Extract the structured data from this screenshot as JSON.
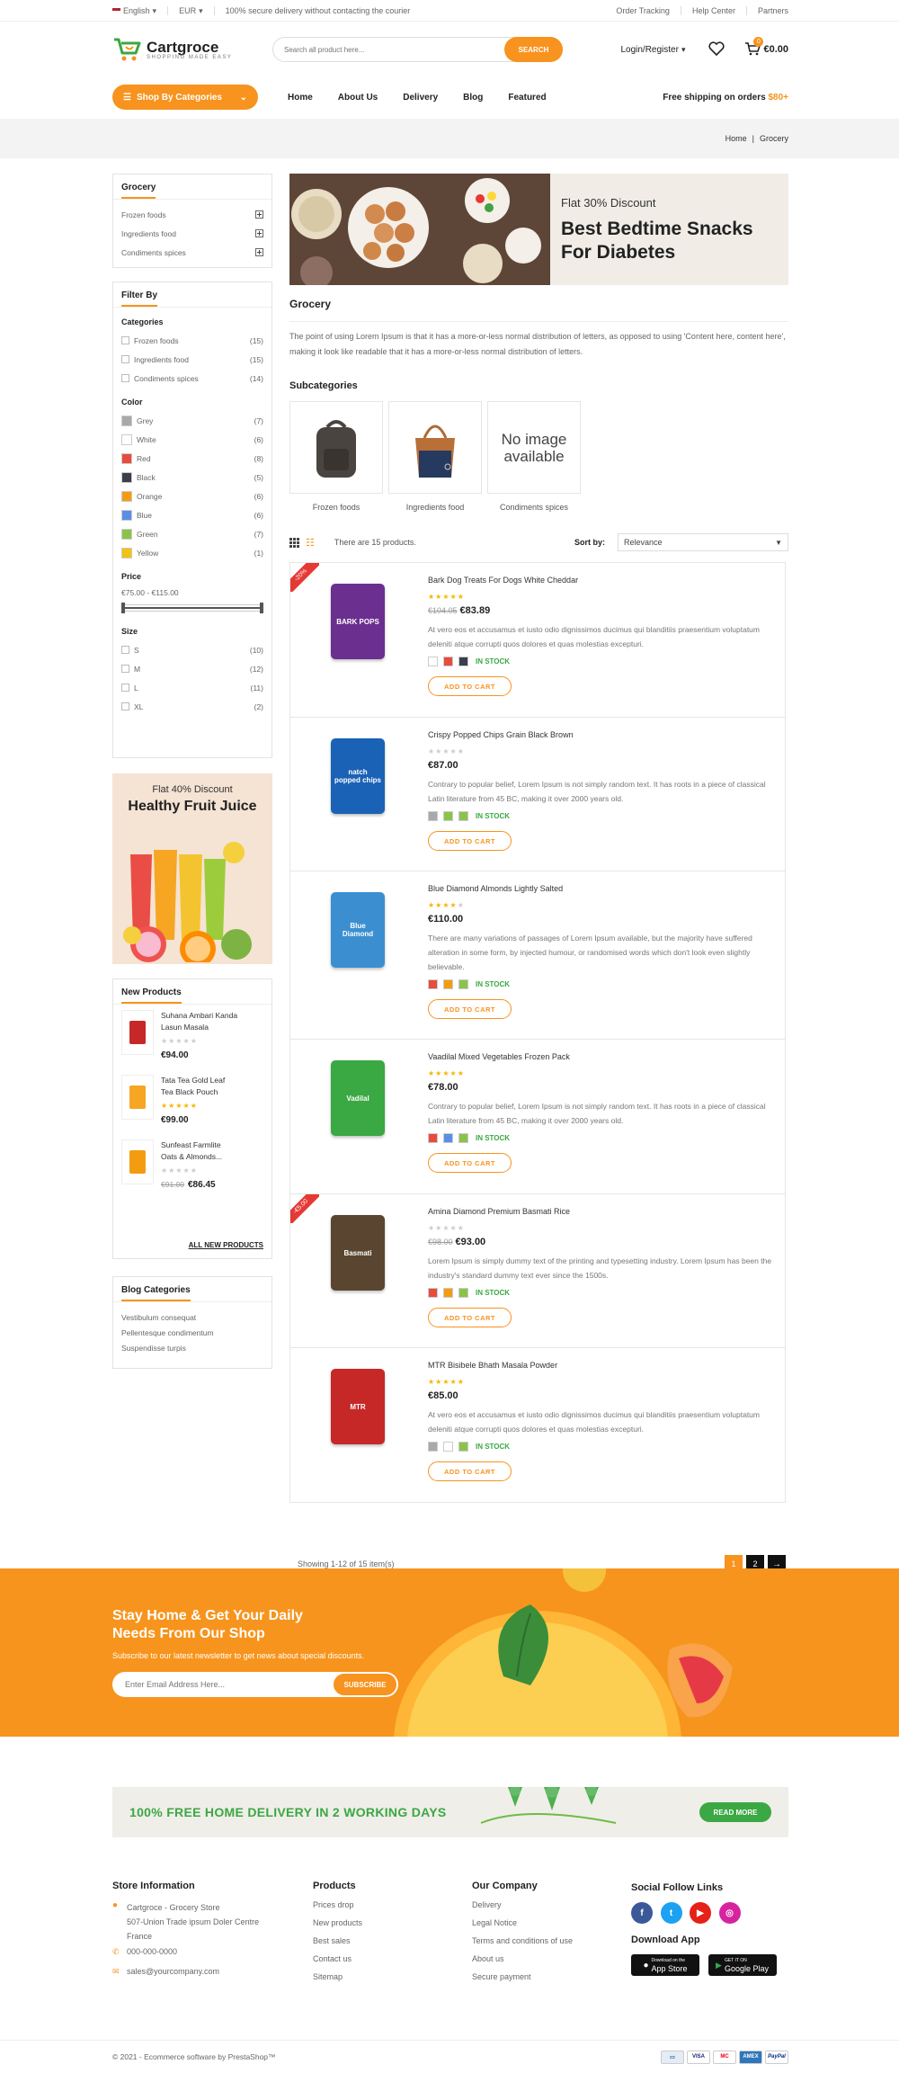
{
  "topbar": {
    "language": "English",
    "currency": "EUR",
    "notice": "100% secure delivery without contacting the courier",
    "links": [
      "Order Tracking",
      "Help Center",
      "Partners"
    ]
  },
  "header": {
    "brand": "Cartgroce",
    "tagline": "SHOPPING MADE EASY",
    "search_placeholder": "Search all product here...",
    "search_button": "SEARCH",
    "account": "Login/Register",
    "cart_count": "0",
    "cart_total": "€0.00"
  },
  "nav": {
    "categories_button": "Shop By Categories",
    "menu": [
      "Home",
      "About Us",
      "Delivery",
      "Blog",
      "Featured"
    ],
    "free_shipping_text": "Free shipping on orders",
    "free_shipping_amount": "$80+"
  },
  "breadcrumb": {
    "home": "Home",
    "sep": "|",
    "current": "Grocery"
  },
  "sidebar": {
    "grocery": {
      "title": "Grocery",
      "items": [
        "Frozen foods",
        "Ingredients food",
        "Condiments spices"
      ]
    },
    "filter": {
      "title": "Filter By",
      "categories_title": "Categories",
      "categories": [
        {
          "label": "Frozen foods",
          "count": "(15)"
        },
        {
          "label": "Ingredients food",
          "count": "(15)"
        },
        {
          "label": "Condiments spices",
          "count": "(14)"
        }
      ],
      "color_title": "Color",
      "colors": [
        {
          "label": "Grey",
          "count": "(7)",
          "hex": "#a7a9ac"
        },
        {
          "label": "White",
          "count": "(6)",
          "hex": "#ffffff"
        },
        {
          "label": "Red",
          "count": "(8)",
          "hex": "#e74c3c"
        },
        {
          "label": "Black",
          "count": "(5)",
          "hex": "#3a3f4b"
        },
        {
          "label": "Orange",
          "count": "(6)",
          "hex": "#f39c12"
        },
        {
          "label": "Blue",
          "count": "(6)",
          "hex": "#5b8fe6"
        },
        {
          "label": "Green",
          "count": "(7)",
          "hex": "#8bc34a"
        },
        {
          "label": "Yellow",
          "count": "(1)",
          "hex": "#f1c40f"
        }
      ],
      "price_title": "Price",
      "price_range": "€75.00 - €115.00",
      "size_title": "Size",
      "sizes": [
        {
          "label": "S",
          "count": "(10)"
        },
        {
          "label": "M",
          "count": "(12)"
        },
        {
          "label": "L",
          "count": "(11)"
        },
        {
          "label": "XL",
          "count": "(2)"
        }
      ]
    },
    "promo": {
      "line1": "Flat 40% Discount",
      "line2": "Healthy Fruit Juice"
    },
    "new_products": {
      "title": "New Products",
      "items": [
        {
          "name1": "Suhana Ambari Kanda",
          "name2": "Lasun Masala",
          "price": "€94.00",
          "old_price": "",
          "rated": false
        },
        {
          "name1": "Tata Tea Gold Leaf",
          "name2": "Tea Black Pouch",
          "price": "€99.00",
          "old_price": "",
          "rated": true
        },
        {
          "name1": "Sunfeast Farmlite",
          "name2": "Oats & Almonds...",
          "price": "€86.45",
          "old_price": "€91.00",
          "rated": false
        }
      ],
      "all_link": "ALL NEW PRODUCTS"
    },
    "blog": {
      "title": "Blog Categories",
      "items": [
        "Vestibulum consequat",
        "Pellentesque condimentum",
        "Suspendisse turpis"
      ]
    }
  },
  "main": {
    "banner": {
      "line1": "Flat 30% Discount",
      "line2": "Best Bedtime Snacks",
      "line3": "For Diabetes"
    },
    "title": "Grocery",
    "description": "The point of using Lorem Ipsum is that it has a more-or-less normal distribution of letters, as opposed to using 'Content here, content here', making it look like readable that it has a more-or-less normal distribution of letters.",
    "subcategories_title": "Subcategories",
    "subcategories": [
      {
        "label": "Frozen foods"
      },
      {
        "label": "Ingredients food"
      },
      {
        "label": "Condiments spices",
        "no_image_text": "No image available"
      }
    ],
    "toolbar": {
      "count_text": "There are 15 products.",
      "sort_label": "Sort by:",
      "sort_value": "Relevance"
    },
    "products": [
      {
        "name": "Bark Dog Treats For Dogs White Cheddar",
        "stars": 5,
        "old_price": "€104.05",
        "price": "€83.89",
        "badge": "-20%",
        "desc": "At vero eos et accusamus et iusto odio dignissimos ducimus qui blanditiis praesentium voluptatum deleniti atque corrupti quos dolores et quas molestias excepturi.",
        "colors": [
          "#ffffff",
          "#e74c3c",
          "#3a3f4b"
        ],
        "stock": "IN STOCK",
        "cart": "ADD TO CART",
        "label": "BARK POPS",
        "img_color": "#6b2f8f"
      },
      {
        "name": "Crispy Popped Chips Grain Black Brown",
        "stars": 0,
        "old_price": "",
        "price": "€87.00",
        "badge": "",
        "desc": "Contrary to popular belief, Lorem Ipsum is not simply random text. It has roots in a piece of classical Latin literature from 45 BC, making it over 2000 years old.",
        "colors": [
          "#a7a9ac",
          "#8bc34a",
          "#8bc34a"
        ],
        "stock": "IN STOCK",
        "cart": "ADD TO CART",
        "label": "natch popped chips",
        "img_color": "#1a62b5"
      },
      {
        "name": "Blue Diamond Almonds Lightly Salted",
        "stars": 4,
        "old_price": "",
        "price": "€110.00",
        "badge": "",
        "desc": "There are many variations of passages of Lorem Ipsum available, but the majority have suffered alteration in some form, by injected humour, or randomised words which don't look even slightly believable.",
        "colors": [
          "#e74c3c",
          "#f39c12",
          "#8bc34a"
        ],
        "stock": "IN STOCK",
        "cart": "ADD TO CART",
        "label": "Blue Diamond",
        "img_color": "#3b8fd0"
      },
      {
        "name": "Vaadilal Mixed Vegetables Frozen Pack",
        "stars": 5,
        "old_price": "",
        "price": "€78.00",
        "badge": "",
        "desc": "Contrary to popular belief, Lorem Ipsum is not simply random text. It has roots in a piece of classical Latin literature from 45 BC, making it over 2000 years old.",
        "colors": [
          "#e74c3c",
          "#5b8fe6",
          "#8bc34a"
        ],
        "stock": "IN STOCK",
        "cart": "ADD TO CART",
        "label": "Vadilal",
        "img_color": "#3aa843"
      },
      {
        "name": "Amina Diamond Premium Basmati Rice",
        "stars": 0,
        "old_price": "€98.00",
        "price": "€93.00",
        "badge": "-€5.00",
        "desc": "Lorem Ipsum is simply dummy text of the printing and typesetting industry. Lorem Ipsum has been the industry's standard dummy text ever since the 1500s.",
        "colors": [
          "#e74c3c",
          "#f39c12",
          "#8bc34a"
        ],
        "stock": "IN STOCK",
        "cart": "ADD TO CART",
        "label": "Basmati",
        "img_color": "#5a4630"
      },
      {
        "name": "MTR Bisibele Bhath Masala Powder",
        "stars": 5,
        "old_price": "",
        "price": "€85.00",
        "badge": "",
        "desc": "At vero eos et accusamus et iusto odio dignissimos ducimus qui blanditiis praesentium voluptatum deleniti atque corrupti quos dolores et quas molestias excepturi.",
        "colors": [
          "#a7a9ac",
          "#ffffff",
          "#8bc34a"
        ],
        "stock": "IN STOCK",
        "cart": "ADD TO CART",
        "label": "MTR",
        "img_color": "#c62828"
      }
    ],
    "pagination": {
      "showing": "Showing 1-12 of 15 item(s)",
      "pages": [
        "1",
        "2"
      ],
      "next": "→"
    }
  },
  "newsletter": {
    "line1": "Stay Home & Get Your Daily",
    "line2": "Needs From Our Shop",
    "sub": "Subscribe to our latest newsletter to get news about special discounts.",
    "placeholder": "Enter Email Address Here...",
    "button": "SUBSCRIBE"
  },
  "delivery_banner": {
    "text": "100% FREE HOME DELIVERY IN 2 WORKING DAYS",
    "button": "READ MORE"
  },
  "footer": {
    "store": {
      "title": "Store Information",
      "address1": "Cartgroce - Grocery Store",
      "address2": "507-Union Trade ipsum Doler Centre",
      "address3": "France",
      "phone": "000-000-0000",
      "email": "sales@yourcompany.com"
    },
    "products": {
      "title": "Products",
      "links": [
        "Prices drop",
        "New products",
        "Best sales",
        "Contact us",
        "Sitemap"
      ]
    },
    "company": {
      "title": "Our Company",
      "links": [
        "Delivery",
        "Legal Notice",
        "Terms and conditions of use",
        "About us",
        "Secure payment"
      ]
    },
    "social": {
      "title": "Social Follow Links",
      "app_title": "Download App",
      "app_store_small": "Download on the",
      "app_store": "App Store",
      "google_small": "GET IT ON",
      "google": "Google Play"
    },
    "copyright": "© 2021 - Ecommerce software by PrestaShop™",
    "payments": [
      "VISA",
      "MC",
      "AMEX",
      "PayPal"
    ]
  },
  "colors": {
    "accent": "#f7931e",
    "green": "#3aa843"
  }
}
